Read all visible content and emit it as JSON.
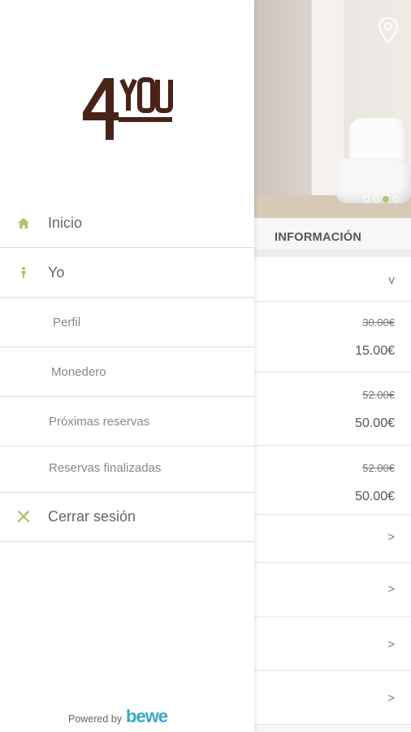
{
  "drawer": {
    "logo_text": "4YOU",
    "menu": [
      {
        "label": "Inicio",
        "icon": "home-icon"
      },
      {
        "label": "Yo",
        "icon": "person-icon"
      },
      {
        "label": "Perfil",
        "icon": ""
      },
      {
        "label": "Monedero",
        "icon": ""
      },
      {
        "label": "Próximas reservas",
        "icon": ""
      },
      {
        "label": "Reservas finalizadas",
        "icon": ""
      },
      {
        "label": "Cerrar sesión",
        "icon": "close-icon"
      }
    ],
    "footer": {
      "powered_by": "Powered by",
      "brand": "bewe"
    }
  },
  "background": {
    "info_label": "INFORMACIÓN",
    "carousel": {
      "count": 4,
      "active": 2
    },
    "services": [
      {
        "old_price": "30.00€",
        "price": "15.00€"
      },
      {
        "old_price": "52.00€",
        "price": "50.00€"
      },
      {
        "old_price": "52.00€",
        "price": "50.00€"
      }
    ],
    "chevron_down": "v",
    "chevron_right": ">"
  },
  "colors": {
    "accent": "#b4c26a",
    "logo_brown": "#4a2318",
    "brand_blue": "#3aa8c8"
  }
}
